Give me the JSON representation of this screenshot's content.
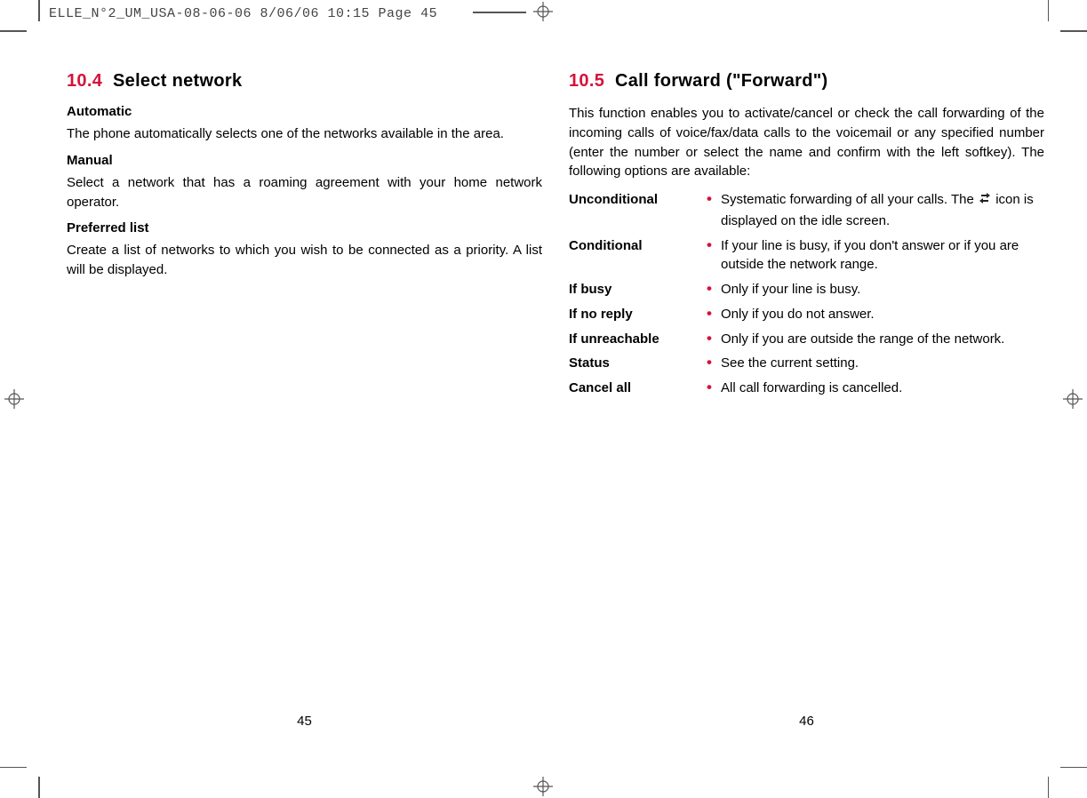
{
  "slug": "ELLE_N°2_UM_USA-08-06-06  8/06/06  10:15  Page 45",
  "left_page": {
    "section_number": "10.4",
    "section_title": "Select network",
    "subsections": [
      {
        "heading": "Automatic",
        "body": "The phone automatically selects one of the networks available in the area."
      },
      {
        "heading": "Manual",
        "body": "Select a network that has a roaming agreement with your home network operator."
      },
      {
        "heading": "Preferred list",
        "body": "Create a list of networks to which you wish to be connected as a priority. A list will be displayed."
      }
    ],
    "page_number": "45"
  },
  "right_page": {
    "section_number": "10.5",
    "section_title": "Call forward (\"Forward\")",
    "intro": "This function enables you to activate/cancel or check the call forwarding of the incoming calls of voice/fax/data calls to the voicemail or any specified number (enter the number or select the name and confirm with the left softkey). The following options are available:",
    "items": [
      {
        "term": "Unconditional",
        "def_pre": "Systematic forwarding of all your calls. The ",
        "icon": "forward-icon",
        "def_post": " icon is displayed on the idle screen."
      },
      {
        "term": "Conditional",
        "def": "If your line is busy, if you don't answer or if you are outside the network range."
      },
      {
        "term": "If busy",
        "def": "Only if your line is busy."
      },
      {
        "term": "If no reply",
        "def": "Only if you do not answer."
      },
      {
        "term": "If unreachable",
        "def": "Only if you are outside the range of the network."
      },
      {
        "term": "Status",
        "def": "See the current setting."
      },
      {
        "term": "Cancel all",
        "def": "All call forwarding is cancelled."
      }
    ],
    "page_number": "46"
  }
}
